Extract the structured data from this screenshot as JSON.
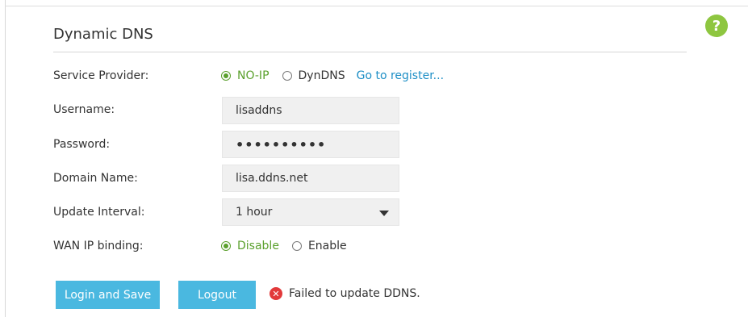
{
  "help": {
    "glyph": "?"
  },
  "section": {
    "title": "Dynamic DNS"
  },
  "form": {
    "service_provider": {
      "label": "Service Provider:",
      "options": [
        "NO-IP",
        "DynDNS"
      ],
      "selected": "NO-IP",
      "register_link": "Go to register..."
    },
    "username": {
      "label": "Username:",
      "value": "lisaddns"
    },
    "password": {
      "label": "Password:",
      "value": "••••••••••"
    },
    "domain_name": {
      "label": "Domain Name:",
      "value": "lisa.ddns.net"
    },
    "update_interval": {
      "label": "Update Interval:",
      "value": "1 hour"
    },
    "wan_ip_binding": {
      "label": "WAN IP binding:",
      "options": [
        "Disable",
        "Enable"
      ],
      "selected": "Disable"
    }
  },
  "actions": {
    "login_save": "Login and Save",
    "logout": "Logout"
  },
  "status": {
    "icon": "error-icon",
    "message": "Failed to update DDNS."
  },
  "colors": {
    "accent_green": "#5aa02c",
    "button_blue": "#4ab8e0",
    "link_blue": "#1e8fc6",
    "error_red": "#e2393a"
  }
}
